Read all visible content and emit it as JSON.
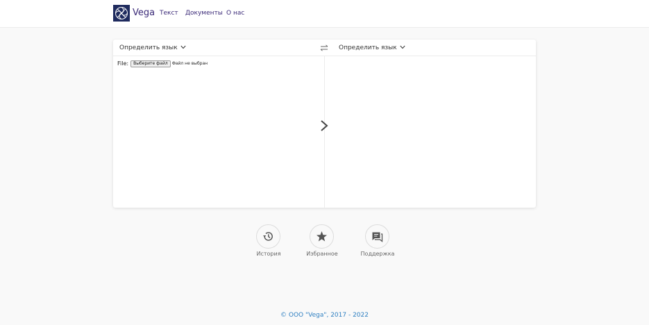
{
  "header": {
    "brand": "Vega",
    "nav": [
      {
        "label": "Текст"
      },
      {
        "label": "Документы"
      },
      {
        "label": "О нас"
      }
    ]
  },
  "translator": {
    "source_language": "Определить язык",
    "target_language": "Определить язык",
    "file": {
      "label": "File:",
      "button_label": "Выберите файл",
      "status": "Файл не выбран"
    }
  },
  "actions": [
    {
      "label": "История",
      "icon": "history-icon"
    },
    {
      "label": "Избранное",
      "icon": "star-icon"
    },
    {
      "label": "Поддержка",
      "icon": "support-chat-icon"
    }
  ],
  "footer": {
    "copyright": "© ООО \"Vega\", 2017 - 2022"
  },
  "colors": {
    "brand": "#3b2a78",
    "logo_bg": "#1f2b5e",
    "footer_link": "#2e7fc1",
    "page_bg": "#f9f9f9"
  }
}
